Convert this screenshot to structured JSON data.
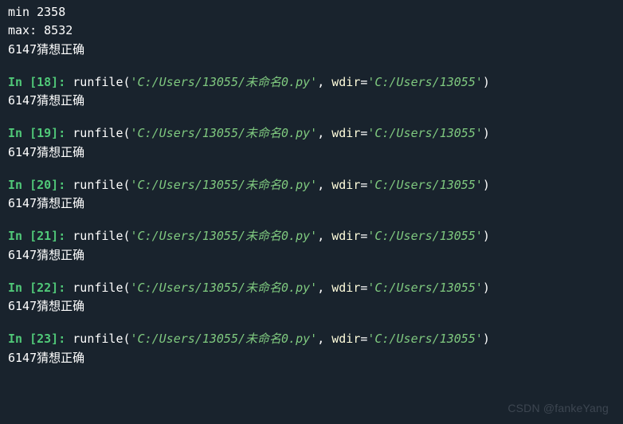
{
  "header": {
    "min_line": "min 2358",
    "max_line": "max: 8532",
    "result": "6147猜想正确"
  },
  "blocks": [
    {
      "n": "18",
      "file": "C:/Users/13055/未命名0.py",
      "wdir": "C:/Users/13055",
      "out": "6147猜想正确"
    },
    {
      "n": "19",
      "file": "C:/Users/13055/未命名0.py",
      "wdir": "C:/Users/13055",
      "out": "6147猜想正确"
    },
    {
      "n": "20",
      "file": "C:/Users/13055/未命名0.py",
      "wdir": "C:/Users/13055",
      "out": "6147猜想正确"
    },
    {
      "n": "21",
      "file": "C:/Users/13055/未命名0.py",
      "wdir": "C:/Users/13055",
      "out": "6147猜想正确"
    },
    {
      "n": "22",
      "file": "C:/Users/13055/未命名0.py",
      "wdir": "C:/Users/13055",
      "out": "6147猜想正确"
    },
    {
      "n": "23",
      "file": "C:/Users/13055/未命名0.py",
      "wdir": "C:/Users/13055",
      "out": "6147猜想正确"
    }
  ],
  "labels": {
    "prompt_prefix": "In [",
    "prompt_suffix": "]: ",
    "func": "runfile",
    "wdir_kw": "wdir"
  },
  "watermark": "CSDN @fankeYang"
}
